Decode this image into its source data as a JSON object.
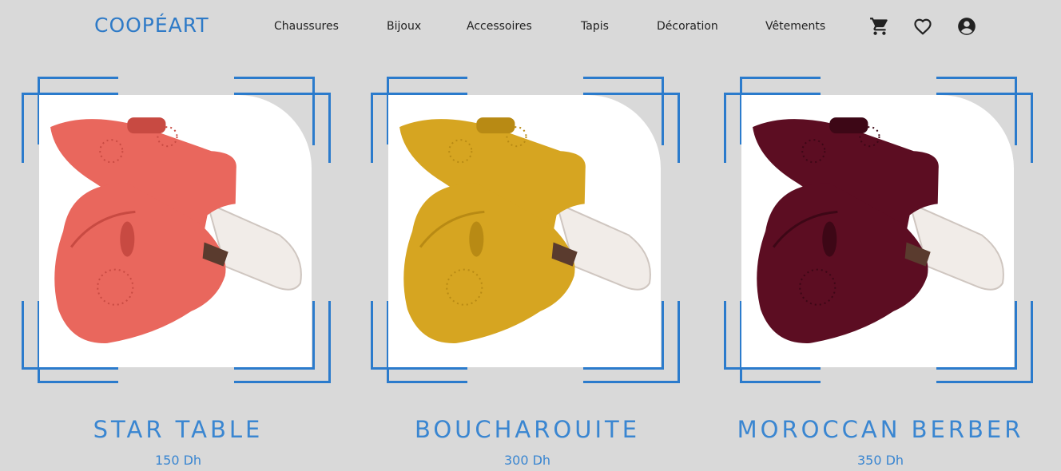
{
  "header": {
    "logo": "COOPÉART",
    "nav": [
      "Chaussures",
      "Bijoux",
      "Accessoires",
      "Tapis",
      "Décoration",
      "Vêtements"
    ],
    "icons": [
      "cart-icon",
      "heart-icon",
      "account-icon"
    ]
  },
  "products": [
    {
      "name": "STAR TABLE",
      "price": "150 Dh",
      "color": "#e9675d",
      "shade": "#c84a42"
    },
    {
      "name": "BOUCHAROUITE",
      "price": "300 Dh",
      "color": "#d6a521",
      "shade": "#b88a14"
    },
    {
      "name": "MOROCCAN BERBER",
      "price": "350 Dh",
      "color": "#5c0d22",
      "shade": "#3d0716"
    }
  ],
  "colors": {
    "accent": "#2b7bcc",
    "background": "#d9d9d9"
  }
}
